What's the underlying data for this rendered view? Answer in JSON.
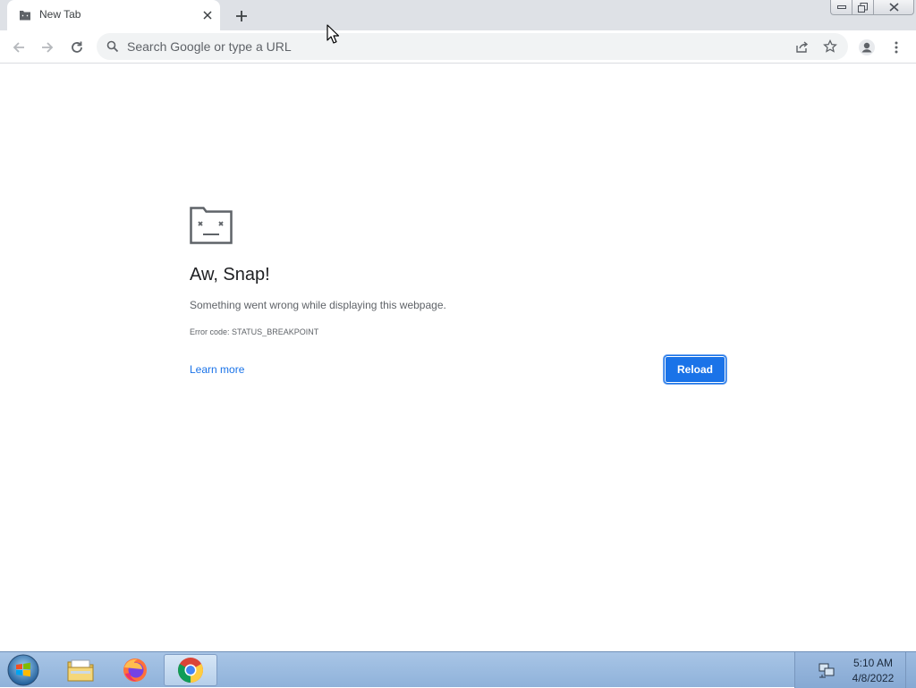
{
  "browser": {
    "tab": {
      "title": "New Tab",
      "favicon": "sad-tab-icon"
    },
    "omnibox": {
      "placeholder": "Search Google or type a URL"
    }
  },
  "error_page": {
    "title": "Aw, Snap!",
    "message": "Something went wrong while displaying this webpage.",
    "error_code": "Error code: STATUS_BREAKPOINT",
    "learn_more": "Learn more",
    "reload": "Reload"
  },
  "taskbar": {
    "items": [
      "windows-start-icon",
      "file-explorer-icon",
      "firefox-icon",
      "chrome-icon"
    ],
    "active_item": "chrome-icon",
    "clock": {
      "time": "5:10 AM",
      "date": "4/8/2022"
    }
  },
  "colors": {
    "accent": "#1a73e8",
    "tabstrip": "#dee1e6",
    "omnibox": "#f1f3f4",
    "taskbar": "#a8c5e6"
  }
}
